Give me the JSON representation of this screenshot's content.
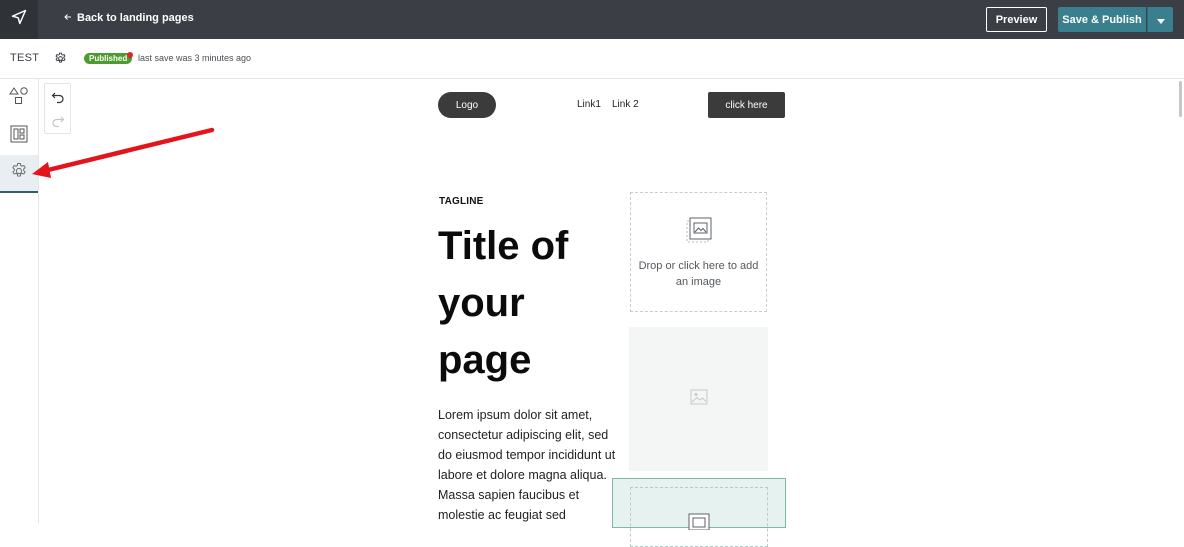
{
  "topbar": {
    "back_label": "Back to landing pages",
    "preview_label": "Preview",
    "save_label": "Save & Publish",
    "accent_color": "#3a7f8e",
    "icons": {
      "app": "send-icon",
      "back": "arrow-left-icon",
      "caret": "caret-down-icon"
    }
  },
  "subbar": {
    "page_name": "TEST",
    "status": "Published",
    "status_color": "#4b9b2e",
    "last_save": "last save was 3 minutes ago"
  },
  "left_rail": {
    "items": [
      {
        "name": "elements",
        "icon": "shapes-icon"
      },
      {
        "name": "sections",
        "icon": "layout-icon"
      },
      {
        "name": "settings",
        "icon": "gear-icon",
        "active": true
      }
    ]
  },
  "history": {
    "undo_icon": "undo-icon",
    "redo_icon": "redo-icon"
  },
  "canvas": {
    "nav": {
      "logo": "Logo",
      "links": [
        "Link1",
        "Link 2"
      ],
      "cta": "click here"
    },
    "hero": {
      "tagline": "TAGLINE",
      "title": "Title of your page",
      "body": "Lorem ipsum dolor sit amet, consectetur adipiscing elit, sed do eiusmod tempor incididunt ut labore et dolore magna aliqua. Massa sapien faucibus et molestie ac feugiat sed"
    },
    "image_drop_text": "Drop or click here to add an image"
  }
}
